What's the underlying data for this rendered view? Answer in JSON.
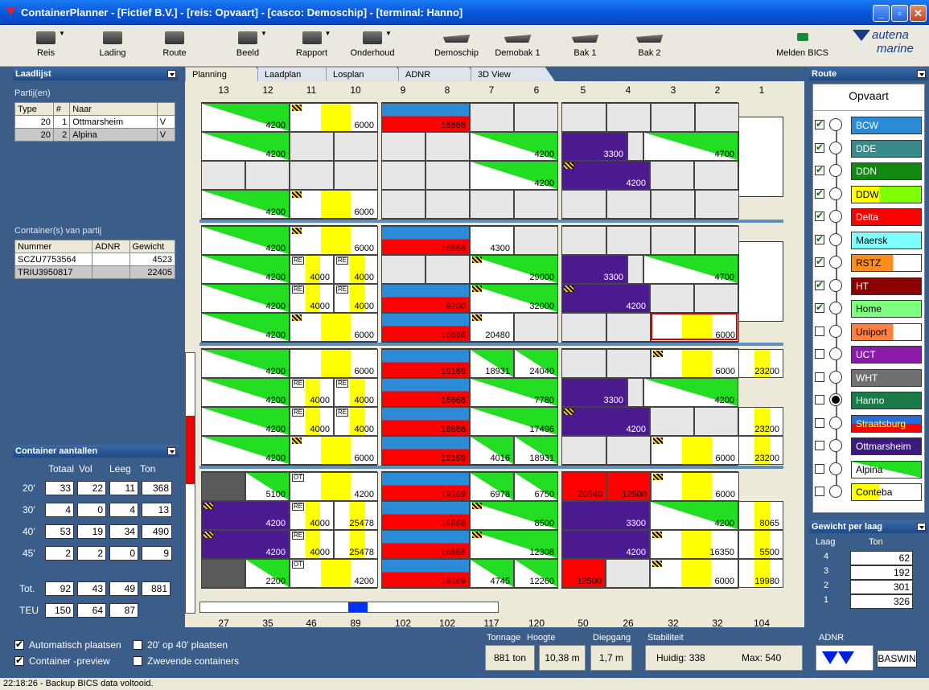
{
  "window": {
    "title": "ContainerPlanner - [Fictief B.V.] - [reis: Opvaart] - [casco: Demoschip] - [terminal: Hanno]"
  },
  "toolbar": [
    {
      "label": "Reis",
      "icon": "walker-icon",
      "drop": true
    },
    {
      "label": "Lading",
      "icon": "cargo-icon",
      "drop": false
    },
    {
      "label": "Route",
      "icon": "book-icon",
      "drop": false
    },
    {
      "label": "Beeld",
      "icon": "bucket-icon",
      "drop": true
    },
    {
      "label": "Rapport",
      "icon": "report-icon",
      "drop": true
    },
    {
      "label": "Onderhoud",
      "icon": "wrench-icon",
      "drop": true
    },
    {
      "label": "Demoschip",
      "icon": "ship-icon",
      "drop": false
    },
    {
      "label": "Demobak 1",
      "icon": "ship-icon",
      "drop": false
    },
    {
      "label": "Bak 1",
      "icon": "ship-icon",
      "drop": false
    },
    {
      "label": "Bak 2",
      "icon": "ship-icon",
      "drop": false
    },
    {
      "label": "Melden BICS",
      "icon": "phone-icon",
      "drop": false
    }
  ],
  "logo": {
    "line1": "autena",
    "line2": "marine"
  },
  "laadlijst": {
    "title": "Laadlijst",
    "partijen_label": "Partij(en)",
    "partij_headers": [
      "Type",
      "#",
      "Naar",
      ""
    ],
    "partijen": [
      [
        "20",
        "1",
        "Ottmarsheim",
        "V"
      ],
      [
        "20",
        "2",
        "Alpina",
        "V"
      ]
    ],
    "containers_label": "Container(s) van partij",
    "container_headers": [
      "Nummer",
      "ADNR",
      "Gewicht"
    ],
    "containers": [
      [
        "SCZU7753564",
        "",
        "4523"
      ],
      [
        "TRIU3950817",
        "",
        "22405"
      ]
    ]
  },
  "aantallen": {
    "title": "Container aantallen",
    "headers": [
      "Totaal",
      "Vol",
      "Leeg",
      "Ton"
    ],
    "rows": [
      {
        "label": "20'",
        "vals": [
          "33",
          "22",
          "11",
          "368"
        ]
      },
      {
        "label": "30'",
        "vals": [
          "4",
          "0",
          "4",
          "13"
        ]
      },
      {
        "label": "40'",
        "vals": [
          "53",
          "19",
          "34",
          "490"
        ]
      },
      {
        "label": "45'",
        "vals": [
          "2",
          "2",
          "0",
          "9"
        ]
      }
    ],
    "tot": {
      "label": "Tot.",
      "vals": [
        "92",
        "43",
        "49",
        "881"
      ]
    },
    "teu": {
      "label": "TEU",
      "vals": [
        "150",
        "64",
        "87"
      ]
    }
  },
  "options": [
    {
      "label": "Automatisch plaatsen",
      "on": true
    },
    {
      "label": "20' op 40' plaatsen",
      "on": false
    },
    {
      "label": "Container -preview",
      "on": true
    },
    {
      "label": "Zwevende containers",
      "on": false
    }
  ],
  "tabs": [
    "Planning",
    "Laadplan",
    "Losplan",
    "ADNR",
    "3D View"
  ],
  "columns": [
    "13",
    "12",
    "11",
    "10",
    "9",
    "8",
    "7",
    "6",
    "5",
    "4",
    "3",
    "2",
    "1"
  ],
  "bay_sums": [
    "27",
    "35",
    "46",
    "89",
    "102",
    "102",
    "117",
    "120",
    "50",
    "26",
    "32",
    "32",
    "104"
  ],
  "tiers": [
    {
      "rows": [
        [
          "4200",
          "6000",
          "16868",
          "",
          "",
          "",
          "4700?"
        ],
        [
          "4200",
          "",
          "",
          "4200",
          "3300",
          "4700",
          ""
        ],
        [
          "",
          "",
          "",
          "4200",
          "4200",
          "",
          ""
        ],
        [
          "4200",
          "6000",
          "",
          "",
          "",
          "",
          ""
        ]
      ]
    }
  ],
  "route": {
    "title": "Route",
    "header": "Opvaart",
    "stops": [
      {
        "name": "BCW",
        "color": "#2b8bd6",
        "on": true
      },
      {
        "name": "DDE",
        "color": "#3a8a8a",
        "on": true
      },
      {
        "name": "DDN",
        "color": "#128a12",
        "on": true
      },
      {
        "name": "DDW",
        "color": "#ffff00",
        "on": true
      },
      {
        "name": "Delta",
        "color": "#ff0000",
        "on": true
      },
      {
        "name": "Maersk",
        "color": "#80ffff",
        "on": true
      },
      {
        "name": "RSTZ",
        "color": "#ff8c1a",
        "on": true
      },
      {
        "name": "HT",
        "color": "#8b0000",
        "on": true
      },
      {
        "name": "Home",
        "color": "#7fff7f",
        "on": true
      },
      {
        "name": "Uniport",
        "color": "#ff7f3f",
        "on": false
      },
      {
        "name": "UCT",
        "color": "#8b1aa8",
        "on": false
      },
      {
        "name": "WHT",
        "color": "#707070",
        "on": false
      },
      {
        "name": "Hanno",
        "color": "#1a7a4a",
        "on": false,
        "current": true
      },
      {
        "name": "Straatsburg",
        "color": "#2b6bd6",
        "on": false
      },
      {
        "name": "Ottmarsheim",
        "color": "#3a1a7a",
        "on": false
      },
      {
        "name": "Alpina",
        "color": "#22dd22",
        "on": false
      },
      {
        "name": "Conteba",
        "color": "#ffff00",
        "on": false
      }
    ]
  },
  "gewicht": {
    "title": "Gewicht per laag",
    "laag_label": "Laag",
    "ton_label": "Ton",
    "rows": [
      [
        "4",
        "62"
      ],
      [
        "3",
        "192"
      ],
      [
        "2",
        "301"
      ],
      [
        "1",
        "326"
      ]
    ]
  },
  "stats": {
    "labels": [
      "Tonnage",
      "Hoogte",
      "Diepgang",
      "Stabiliteit"
    ],
    "tonnage": "881 ton",
    "hoogte": "10,38 m",
    "diepgang": "1,7 m",
    "huidig": "Huidig: 338",
    "max": "Max: 540",
    "adnr": "ADNR",
    "baswin": "BASWIN"
  },
  "status": "22:18:26 - Backup BICS data voltooid."
}
